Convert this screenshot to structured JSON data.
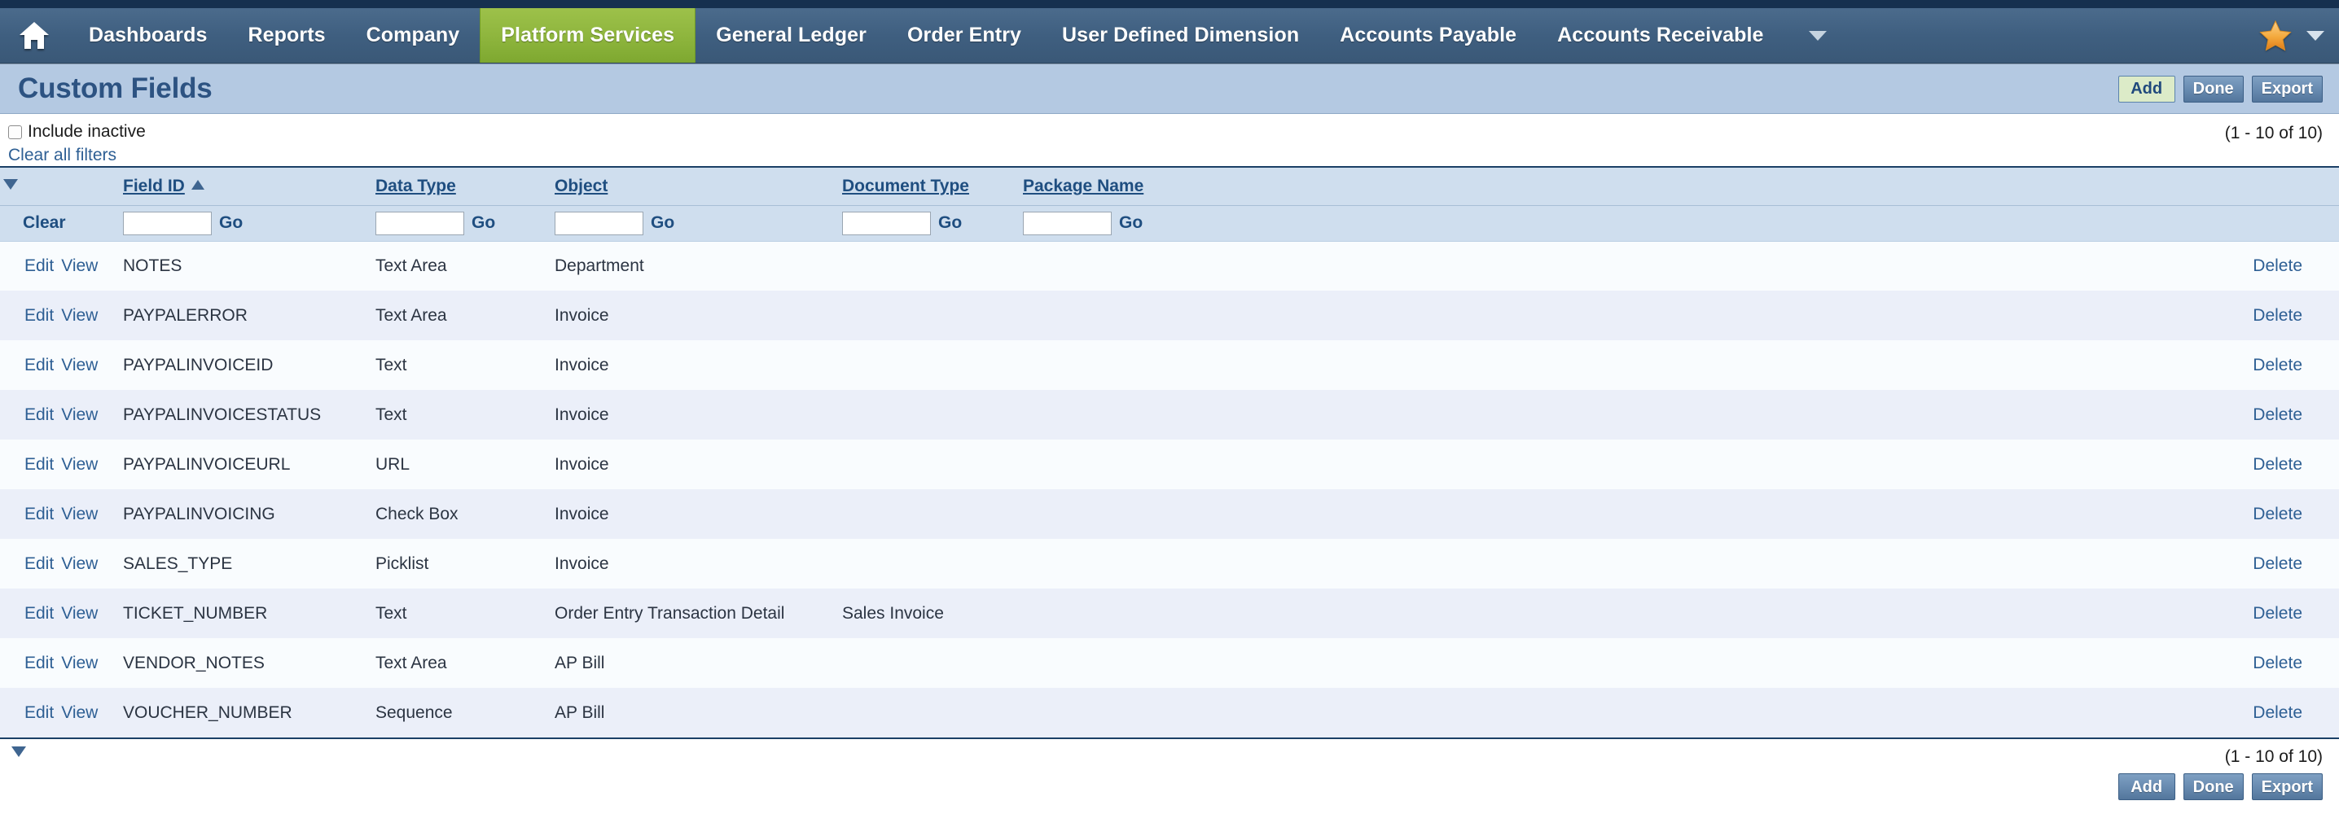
{
  "nav": {
    "home_icon": "home-icon",
    "items": [
      {
        "label": "Dashboards",
        "active": false
      },
      {
        "label": "Reports",
        "active": false
      },
      {
        "label": "Company",
        "active": false
      },
      {
        "label": "Platform Services",
        "active": true
      },
      {
        "label": "General Ledger",
        "active": false
      },
      {
        "label": "Order Entry",
        "active": false
      },
      {
        "label": "User Defined Dimension",
        "active": false
      },
      {
        "label": "Accounts Payable",
        "active": false
      },
      {
        "label": "Accounts Receivable",
        "active": false
      }
    ],
    "overflow_icon": "chevron-down-icon",
    "favorites_icon": "star-icon",
    "favorites_caret_icon": "chevron-down-icon",
    "active_color": "#8fb63e",
    "bar_color": "#3f5f80"
  },
  "header": {
    "title": "Custom Fields",
    "buttons": [
      {
        "label": "Add",
        "style": "green"
      },
      {
        "label": "Done",
        "style": "blue"
      },
      {
        "label": "Export",
        "style": "blue"
      }
    ]
  },
  "filters": {
    "include_inactive_label": "Include inactive",
    "include_inactive_checked": false,
    "clear_all_filters_label": "Clear all filters",
    "record_count_top": "(1 - 10 of 10)"
  },
  "table": {
    "toggle_icon": "caret-down-icon",
    "columns": [
      {
        "key": "actions",
        "label": "",
        "sorted": false
      },
      {
        "key": "field_id",
        "label": "Field ID",
        "sorted": true,
        "sort_dir": "asc"
      },
      {
        "key": "data_type",
        "label": "Data Type",
        "sorted": false
      },
      {
        "key": "object",
        "label": "Object",
        "sorted": false
      },
      {
        "key": "document_type",
        "label": "Document Type",
        "sorted": false
      },
      {
        "key": "package_name",
        "label": "Package Name",
        "sorted": false
      }
    ],
    "filter_row": {
      "clear_label": "Clear",
      "go_label": "Go",
      "field_id_value": "",
      "data_type_value": "",
      "object_value": "",
      "document_type_value": "",
      "package_name_value": ""
    },
    "row_actions": {
      "edit_label": "Edit",
      "view_label": "View",
      "delete_label": "Delete"
    },
    "rows": [
      {
        "field_id": "NOTES",
        "data_type": "Text Area",
        "object": "Department",
        "document_type": "",
        "package_name": ""
      },
      {
        "field_id": "PAYPALERROR",
        "data_type": "Text Area",
        "object": "Invoice",
        "document_type": "",
        "package_name": ""
      },
      {
        "field_id": "PAYPALINVOICEID",
        "data_type": "Text",
        "object": "Invoice",
        "document_type": "",
        "package_name": ""
      },
      {
        "field_id": "PAYPALINVOICESTATUS",
        "data_type": "Text",
        "object": "Invoice",
        "document_type": "",
        "package_name": ""
      },
      {
        "field_id": "PAYPALINVOICEURL",
        "data_type": "URL",
        "object": "Invoice",
        "document_type": "",
        "package_name": ""
      },
      {
        "field_id": "PAYPALINVOICING",
        "data_type": "Check Box",
        "object": "Invoice",
        "document_type": "",
        "package_name": ""
      },
      {
        "field_id": "SALES_TYPE",
        "data_type": "Picklist",
        "object": "Invoice",
        "document_type": "",
        "package_name": ""
      },
      {
        "field_id": "TICKET_NUMBER",
        "data_type": "Text",
        "object": "Order Entry Transaction Detail",
        "document_type": "Sales Invoice",
        "package_name": ""
      },
      {
        "field_id": "VENDOR_NOTES",
        "data_type": "Text Area",
        "object": "AP Bill",
        "document_type": "",
        "package_name": ""
      },
      {
        "field_id": "VOUCHER_NUMBER",
        "data_type": "Sequence",
        "object": "AP Bill",
        "document_type": "",
        "package_name": ""
      }
    ]
  },
  "footer": {
    "toggle_icon": "caret-down-icon",
    "record_count_bottom": "(1 - 10 of 10)",
    "buttons": [
      {
        "label": "Add",
        "style": "blue"
      },
      {
        "label": "Done",
        "style": "blue"
      },
      {
        "label": "Export",
        "style": "blue"
      }
    ]
  }
}
